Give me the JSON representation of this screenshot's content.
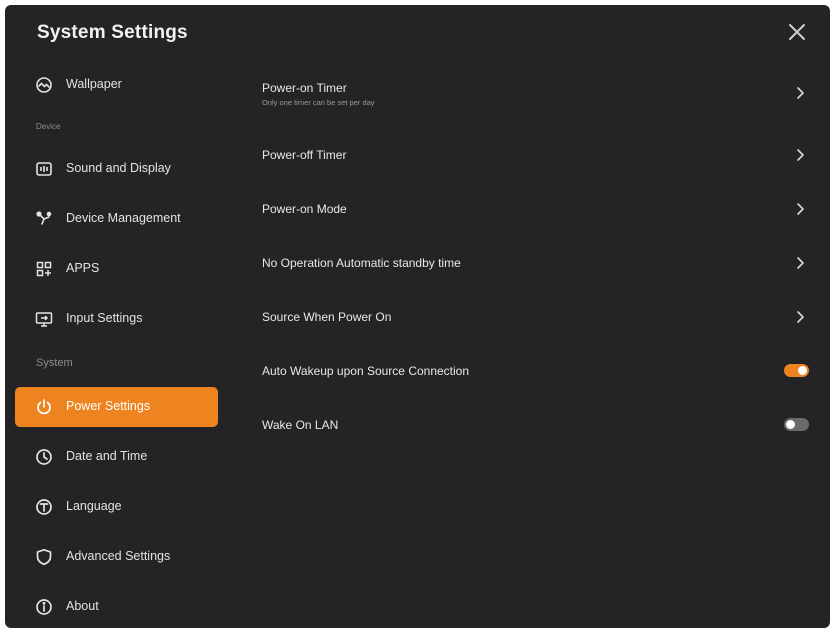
{
  "window": {
    "title": "System Settings",
    "close_icon": "close-icon"
  },
  "sidebar": {
    "items": [
      {
        "label": "Wallpaper",
        "icon": "wallpaper-icon",
        "active": false
      },
      {
        "label": "Sound and Display",
        "icon": "sound-display-icon",
        "active": false
      },
      {
        "label": "Device Management",
        "icon": "device-management-icon",
        "active": false
      },
      {
        "label": "APPS",
        "icon": "apps-icon",
        "active": false
      },
      {
        "label": "Input Settings",
        "icon": "input-settings-icon",
        "active": false
      },
      {
        "label": "Power Settings",
        "icon": "power-icon",
        "active": true
      },
      {
        "label": "Date and Time",
        "icon": "clock-icon",
        "active": false
      },
      {
        "label": "Language",
        "icon": "language-icon",
        "active": false
      },
      {
        "label": "Advanced Settings",
        "icon": "shield-icon",
        "active": false
      },
      {
        "label": "About",
        "icon": "info-icon",
        "active": false
      }
    ],
    "sections": {
      "device": "Device",
      "system": "System"
    }
  },
  "main": {
    "rows": [
      {
        "label": "Power-on Timer",
        "sublabel": "Only one timer can be set per day",
        "control": "chevron"
      },
      {
        "label": "Power-off Timer",
        "control": "chevron"
      },
      {
        "label": "Power-on Mode",
        "control": "chevron"
      },
      {
        "label": "No Operation Automatic standby time",
        "control": "chevron"
      },
      {
        "label": "Source When Power On",
        "control": "chevron"
      },
      {
        "label": "Auto Wakeup upon Source Connection",
        "control": "toggle",
        "enabled": true
      },
      {
        "label": "Wake On LAN",
        "control": "toggle",
        "enabled": false
      }
    ]
  },
  "colors": {
    "background": "#242427",
    "accent": "#ee8420",
    "toggle_off": "#6a6a6d",
    "text": "#e6e6e6",
    "muted_text": "#8d8d8f"
  }
}
